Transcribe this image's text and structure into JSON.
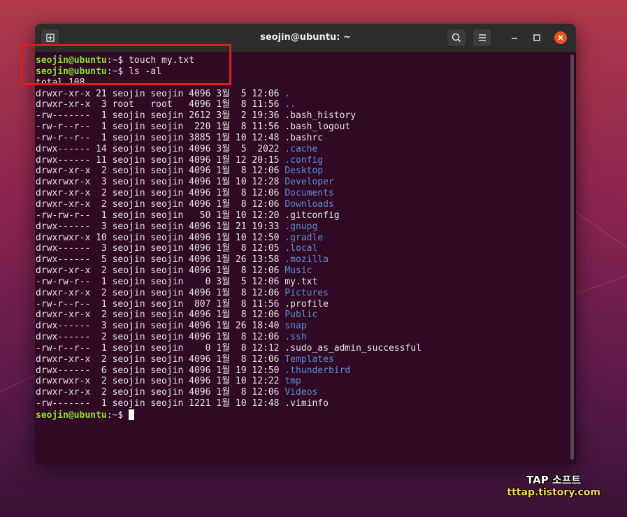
{
  "window": {
    "title": "seojin@ubuntu: ~",
    "accent_close": "#e95420",
    "icons": {
      "new_tab": "new-tab-icon",
      "search": "search-icon",
      "menu": "hamburger-menu-icon",
      "minimize": "minimize-icon",
      "maximize": "maximize-icon",
      "close": "close-icon"
    }
  },
  "terminal": {
    "prompt_user": "seojin@ubuntu",
    "prompt_path": "~",
    "prompt_symbol": "$",
    "commands": [
      "touch my.txt",
      "ls -al"
    ],
    "total": "total 108",
    "rows": [
      {
        "perm": "drwxr-xr-x",
        "links": "21",
        "user": "seojin",
        "group": "seojin",
        "size": "4096",
        "month": "3월",
        "day": "5",
        "time": "12:06",
        "name": ".",
        "type": "dir"
      },
      {
        "perm": "drwxr-xr-x",
        "links": "3",
        "user": "root",
        "group": "root",
        "size": "4096",
        "month": "1월",
        "day": "8",
        "time": "11:56",
        "name": "..",
        "type": "dir"
      },
      {
        "perm": "-rw-------",
        "links": "1",
        "user": "seojin",
        "group": "seojin",
        "size": "2612",
        "month": "3월",
        "day": "2",
        "time": "19:36",
        "name": ".bash_history",
        "type": "file"
      },
      {
        "perm": "-rw-r--r--",
        "links": "1",
        "user": "seojin",
        "group": "seojin",
        "size": "220",
        "month": "1월",
        "day": "8",
        "time": "11:56",
        "name": ".bash_logout",
        "type": "file"
      },
      {
        "perm": "-rw-r--r--",
        "links": "1",
        "user": "seojin",
        "group": "seojin",
        "size": "3885",
        "month": "1월",
        "day": "10",
        "time": "12:48",
        "name": ".bashrc",
        "type": "file"
      },
      {
        "perm": "drwx------",
        "links": "14",
        "user": "seojin",
        "group": "seojin",
        "size": "4096",
        "month": "3월",
        "day": "5",
        "time": "2022",
        "name": ".cache",
        "type": "dir"
      },
      {
        "perm": "drwx------",
        "links": "11",
        "user": "seojin",
        "group": "seojin",
        "size": "4096",
        "month": "1월",
        "day": "12",
        "time": "20:15",
        "name": ".config",
        "type": "dir"
      },
      {
        "perm": "drwxr-xr-x",
        "links": "2",
        "user": "seojin",
        "group": "seojin",
        "size": "4096",
        "month": "1월",
        "day": "8",
        "time": "12:06",
        "name": "Desktop",
        "type": "dir"
      },
      {
        "perm": "drwxrwxr-x",
        "links": "3",
        "user": "seojin",
        "group": "seojin",
        "size": "4096",
        "month": "1월",
        "day": "10",
        "time": "12:28",
        "name": "Developer",
        "type": "dir"
      },
      {
        "perm": "drwxr-xr-x",
        "links": "2",
        "user": "seojin",
        "group": "seojin",
        "size": "4096",
        "month": "1월",
        "day": "8",
        "time": "12:06",
        "name": "Documents",
        "type": "dir"
      },
      {
        "perm": "drwxr-xr-x",
        "links": "2",
        "user": "seojin",
        "group": "seojin",
        "size": "4096",
        "month": "1월",
        "day": "8",
        "time": "12:06",
        "name": "Downloads",
        "type": "dir"
      },
      {
        "perm": "-rw-rw-r--",
        "links": "1",
        "user": "seojin",
        "group": "seojin",
        "size": "50",
        "month": "1월",
        "day": "10",
        "time": "12:20",
        "name": ".gitconfig",
        "type": "file"
      },
      {
        "perm": "drwx------",
        "links": "3",
        "user": "seojin",
        "group": "seojin",
        "size": "4096",
        "month": "1월",
        "day": "21",
        "time": "19:33",
        "name": ".gnupg",
        "type": "dir"
      },
      {
        "perm": "drwxrwxr-x",
        "links": "10",
        "user": "seojin",
        "group": "seojin",
        "size": "4096",
        "month": "1월",
        "day": "10",
        "time": "12:50",
        "name": ".gradle",
        "type": "dir"
      },
      {
        "perm": "drwx------",
        "links": "3",
        "user": "seojin",
        "group": "seojin",
        "size": "4096",
        "month": "1월",
        "day": "8",
        "time": "12:05",
        "name": ".local",
        "type": "dir"
      },
      {
        "perm": "drwx------",
        "links": "5",
        "user": "seojin",
        "group": "seojin",
        "size": "4096",
        "month": "1월",
        "day": "26",
        "time": "13:58",
        "name": ".mozilla",
        "type": "dir"
      },
      {
        "perm": "drwxr-xr-x",
        "links": "2",
        "user": "seojin",
        "group": "seojin",
        "size": "4096",
        "month": "1월",
        "day": "8",
        "time": "12:06",
        "name": "Music",
        "type": "dir"
      },
      {
        "perm": "-rw-rw-r--",
        "links": "1",
        "user": "seojin",
        "group": "seojin",
        "size": "0",
        "month": "3월",
        "day": "5",
        "time": "12:06",
        "name": "my.txt",
        "type": "file"
      },
      {
        "perm": "drwxr-xr-x",
        "links": "2",
        "user": "seojin",
        "group": "seojin",
        "size": "4096",
        "month": "1월",
        "day": "8",
        "time": "12:06",
        "name": "Pictures",
        "type": "dir"
      },
      {
        "perm": "-rw-r--r--",
        "links": "1",
        "user": "seojin",
        "group": "seojin",
        "size": "807",
        "month": "1월",
        "day": "8",
        "time": "11:56",
        "name": ".profile",
        "type": "file"
      },
      {
        "perm": "drwxr-xr-x",
        "links": "2",
        "user": "seojin",
        "group": "seojin",
        "size": "4096",
        "month": "1월",
        "day": "8",
        "time": "12:06",
        "name": "Public",
        "type": "dir"
      },
      {
        "perm": "drwx------",
        "links": "3",
        "user": "seojin",
        "group": "seojin",
        "size": "4096",
        "month": "1월",
        "day": "26",
        "time": "18:40",
        "name": "snap",
        "type": "dir"
      },
      {
        "perm": "drwx------",
        "links": "2",
        "user": "seojin",
        "group": "seojin",
        "size": "4096",
        "month": "1월",
        "day": "8",
        "time": "12:06",
        "name": ".ssh",
        "type": "dir"
      },
      {
        "perm": "-rw-r--r--",
        "links": "1",
        "user": "seojin",
        "group": "seojin",
        "size": "0",
        "month": "1월",
        "day": "8",
        "time": "12:12",
        "name": ".sudo_as_admin_successful",
        "type": "file"
      },
      {
        "perm": "drwxr-xr-x",
        "links": "2",
        "user": "seojin",
        "group": "seojin",
        "size": "4096",
        "month": "1월",
        "day": "8",
        "time": "12:06",
        "name": "Templates",
        "type": "dir"
      },
      {
        "perm": "drwx------",
        "links": "6",
        "user": "seojin",
        "group": "seojin",
        "size": "4096",
        "month": "1월",
        "day": "19",
        "time": "12:50",
        "name": ".thunderbird",
        "type": "dir"
      },
      {
        "perm": "drwxrwxr-x",
        "links": "2",
        "user": "seojin",
        "group": "seojin",
        "size": "4096",
        "month": "1월",
        "day": "10",
        "time": "12:22",
        "name": "tmp",
        "type": "dir"
      },
      {
        "perm": "drwxr-xr-x",
        "links": "2",
        "user": "seojin",
        "group": "seojin",
        "size": "4096",
        "month": "1월",
        "day": "8",
        "time": "12:06",
        "name": "Videos",
        "type": "dir"
      },
      {
        "perm": "-rw-------",
        "links": "1",
        "user": "seojin",
        "group": "seojin",
        "size": "1221",
        "month": "1월",
        "day": "10",
        "time": "12:48",
        "name": ".viminfo",
        "type": "file"
      }
    ]
  },
  "watermark": {
    "line1": "TAP 소프트",
    "line2": "tttap.tistory.com"
  },
  "colors": {
    "terminal_bg": "#300a24",
    "prompt_user": "#8ae234",
    "prompt_path": "#729fcf",
    "directory": "#5c8dd6",
    "highlight_box": "#e51b1b"
  }
}
